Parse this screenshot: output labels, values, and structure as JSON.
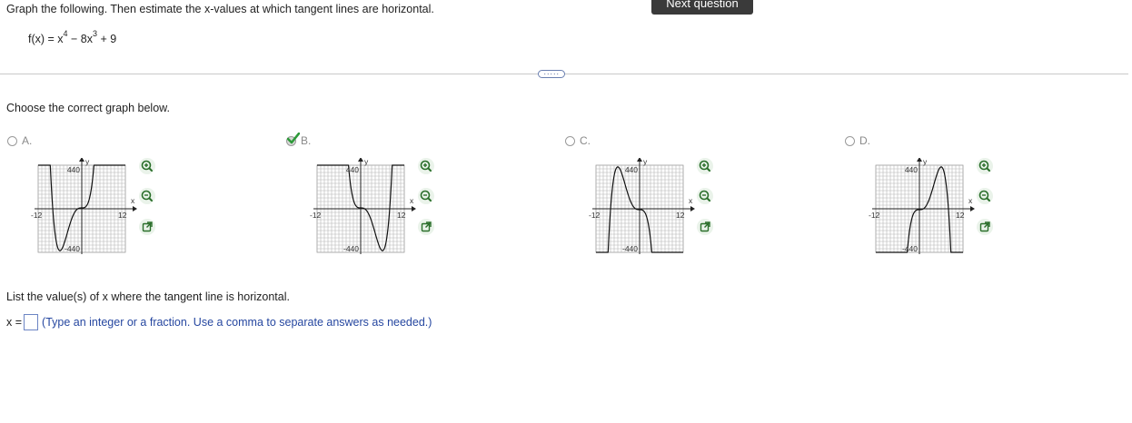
{
  "question": {
    "instructions": "Graph the following. Then estimate the x-values at which tangent lines are horizontal.",
    "formula": {
      "lhs": "f(x) = x",
      "exp1": "4",
      "mid": " − 8x",
      "exp2": "3",
      "rhs": " + 9"
    }
  },
  "header": {
    "next_question_label": "Next question"
  },
  "divider": {
    "handle_label": "·····"
  },
  "choose_prompt": "Choose the correct graph below.",
  "options": [
    {
      "label": "A.",
      "selected": false
    },
    {
      "label": "B.",
      "selected": true
    },
    {
      "label": "C.",
      "selected": false
    },
    {
      "label": "D.",
      "selected": false
    }
  ],
  "axes": {
    "y_top": "440",
    "y_bottom": "-440",
    "x_left": "-12",
    "x_right": "12",
    "x_name": "x",
    "y_name": "y"
  },
  "colors": {
    "accent": "#2647a0",
    "input_border": "#6c85c4",
    "check": "#2e9a3a",
    "zoom_icon": "#2a6e2a"
  },
  "icons": [
    "zoom-in-icon",
    "zoom-out-icon",
    "pop-out-icon",
    "check-mark-icon"
  ],
  "answer": {
    "prefix": "x =",
    "value": "",
    "hint": "(Type an integer or a fraction. Use a comma to separate answers as needed.)"
  },
  "list_prompt": "List the value(s) of x where the tangent line is horizontal."
}
